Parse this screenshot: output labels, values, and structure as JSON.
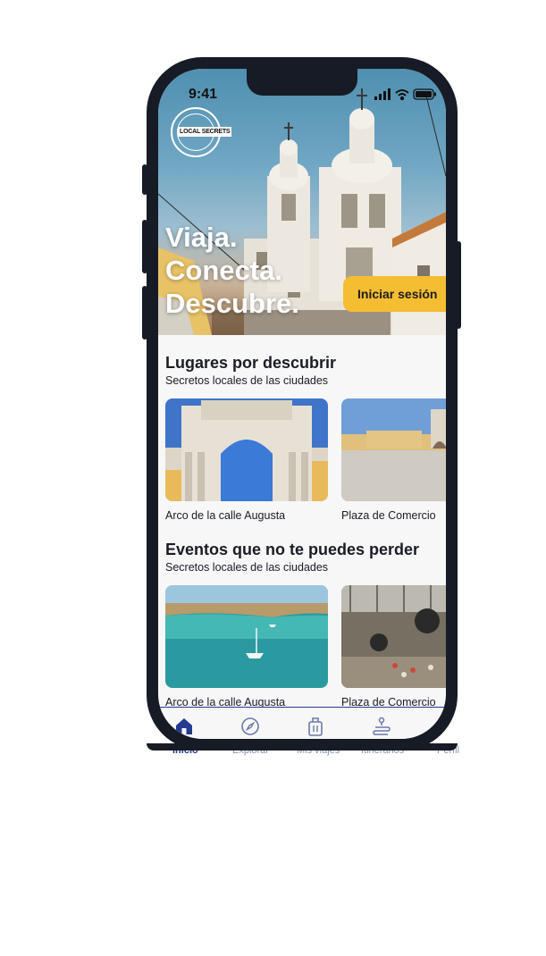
{
  "status_bar": {
    "time": "9:41"
  },
  "hero": {
    "logo_text": "LOCAL SECRETS",
    "tagline": [
      "Viaja.",
      "Conecta.",
      "Descubre."
    ],
    "login_label": "Iniciar sesión"
  },
  "places": {
    "title": "Lugares por descubrir",
    "subtitle": "Secretos locales de las ciudades",
    "cards": [
      {
        "caption": "Arco de la calle Augusta"
      },
      {
        "caption": "Plaza de Comercio"
      }
    ]
  },
  "events": {
    "title": "Eventos que no te puedes perder",
    "subtitle": "Secretos locales de las ciudades",
    "cards": [
      {
        "caption": "Arco de la calle Augusta"
      },
      {
        "caption": "Plaza de Comercio"
      }
    ]
  },
  "tabs": [
    {
      "label": "Inicio",
      "icon": "home-icon",
      "active": true
    },
    {
      "label": "Explorar",
      "icon": "compass-icon",
      "active": false
    },
    {
      "label": "Mis viajes",
      "icon": "luggage-icon",
      "active": false
    },
    {
      "label": "Itinerarios",
      "icon": "route-icon",
      "active": false
    },
    {
      "label": "Perfil",
      "icon": "profile-icon",
      "active": false
    }
  ],
  "colors": {
    "accent": "#f4bd32",
    "tab_active": "#243a8f",
    "tab_inactive": "#6b7aa8",
    "frame": "#161b25"
  }
}
